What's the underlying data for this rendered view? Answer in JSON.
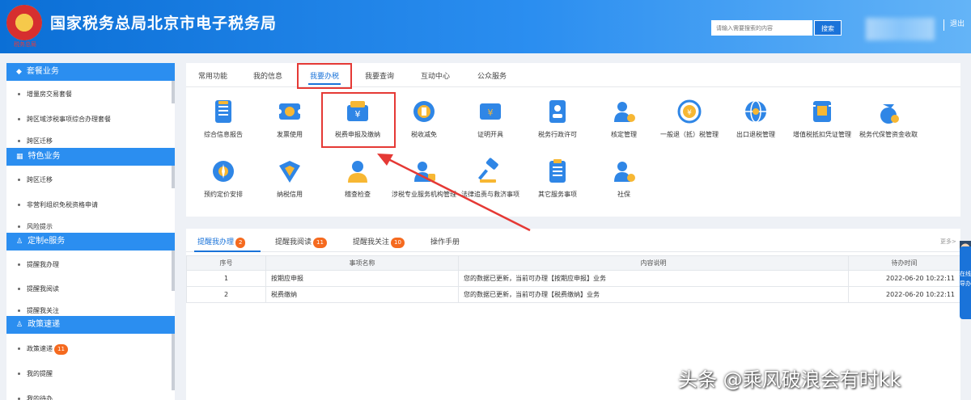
{
  "header": {
    "title": "国家税务总局北京市电子税务局",
    "emblem_text": "税务总局",
    "search_placeholder": "请输入需要搜索的内容",
    "search_button": "搜索",
    "logout": "退出"
  },
  "sidebar": {
    "sections": [
      {
        "title": "套餐业务",
        "icon": "package-icon",
        "items": [
          "增量房交易套餐",
          "跨区域涉税事项综合办理套餐",
          "跨区迁移"
        ]
      },
      {
        "title": "特色业务",
        "icon": "grid-icon",
        "items": [
          "跨区迁移",
          "非营利组织免税资格申请",
          "风险提示"
        ]
      },
      {
        "title": "定制e服务",
        "icon": "user-icon",
        "items": [
          "提醒我办理",
          "提醒我阅读",
          "提醒我关注"
        ]
      },
      {
        "title": "政策速递",
        "icon": "user-icon",
        "items": [
          "政策速递",
          "我的提醒",
          "我的待办"
        ],
        "badge": "11"
      }
    ]
  },
  "main_tabs": {
    "tabs": [
      "常用功能",
      "我的信息",
      "我要办税",
      "我要查询",
      "互动中心",
      "公众服务"
    ],
    "active": "我要办税"
  },
  "functions": {
    "row1": [
      "综合信息报告",
      "发票使用",
      "税费申报及缴纳",
      "税收减免",
      "证明开具",
      "税务行政许可",
      "核定管理",
      "一般退（抵）税管理",
      "出口退税管理",
      "增值税抵扣凭证管理",
      "税务代保管资金收取"
    ],
    "row2": [
      "预约定价安排",
      "纳税信用",
      "稽查检查",
      "涉税专业服务机构管理",
      "法律追责与救济事项",
      "其它服务事项",
      "社保"
    ]
  },
  "reminders": {
    "tabs": [
      {
        "label": "提醒我办理",
        "count": "2"
      },
      {
        "label": "提醒我阅读",
        "count": "11"
      },
      {
        "label": "提醒我关注",
        "count": "10"
      },
      {
        "label": "操作手册",
        "count": ""
      }
    ],
    "more": "更多>",
    "columns": [
      "序号",
      "事项名称",
      "内容说明",
      "待办时间"
    ],
    "rows": [
      {
        "no": "1",
        "name": "按期应申报",
        "desc": "您的数据已更新，当前可办理【按期应申报】业务",
        "time": "2022-06-20 10:22:11"
      },
      {
        "no": "2",
        "name": "税费缴纳",
        "desc": "您的数据已更新，当前可办理【税费缴纳】业务",
        "time": "2022-06-20 10:22:11"
      }
    ]
  },
  "float_widget": {
    "text": "在线导办"
  },
  "watermark": "头条 @乘风破浪会有时kk",
  "colors": {
    "primary": "#1a73d9",
    "header_start": "#0b6fd6",
    "highlight": "#e53935",
    "badge": "#f56a1f"
  }
}
